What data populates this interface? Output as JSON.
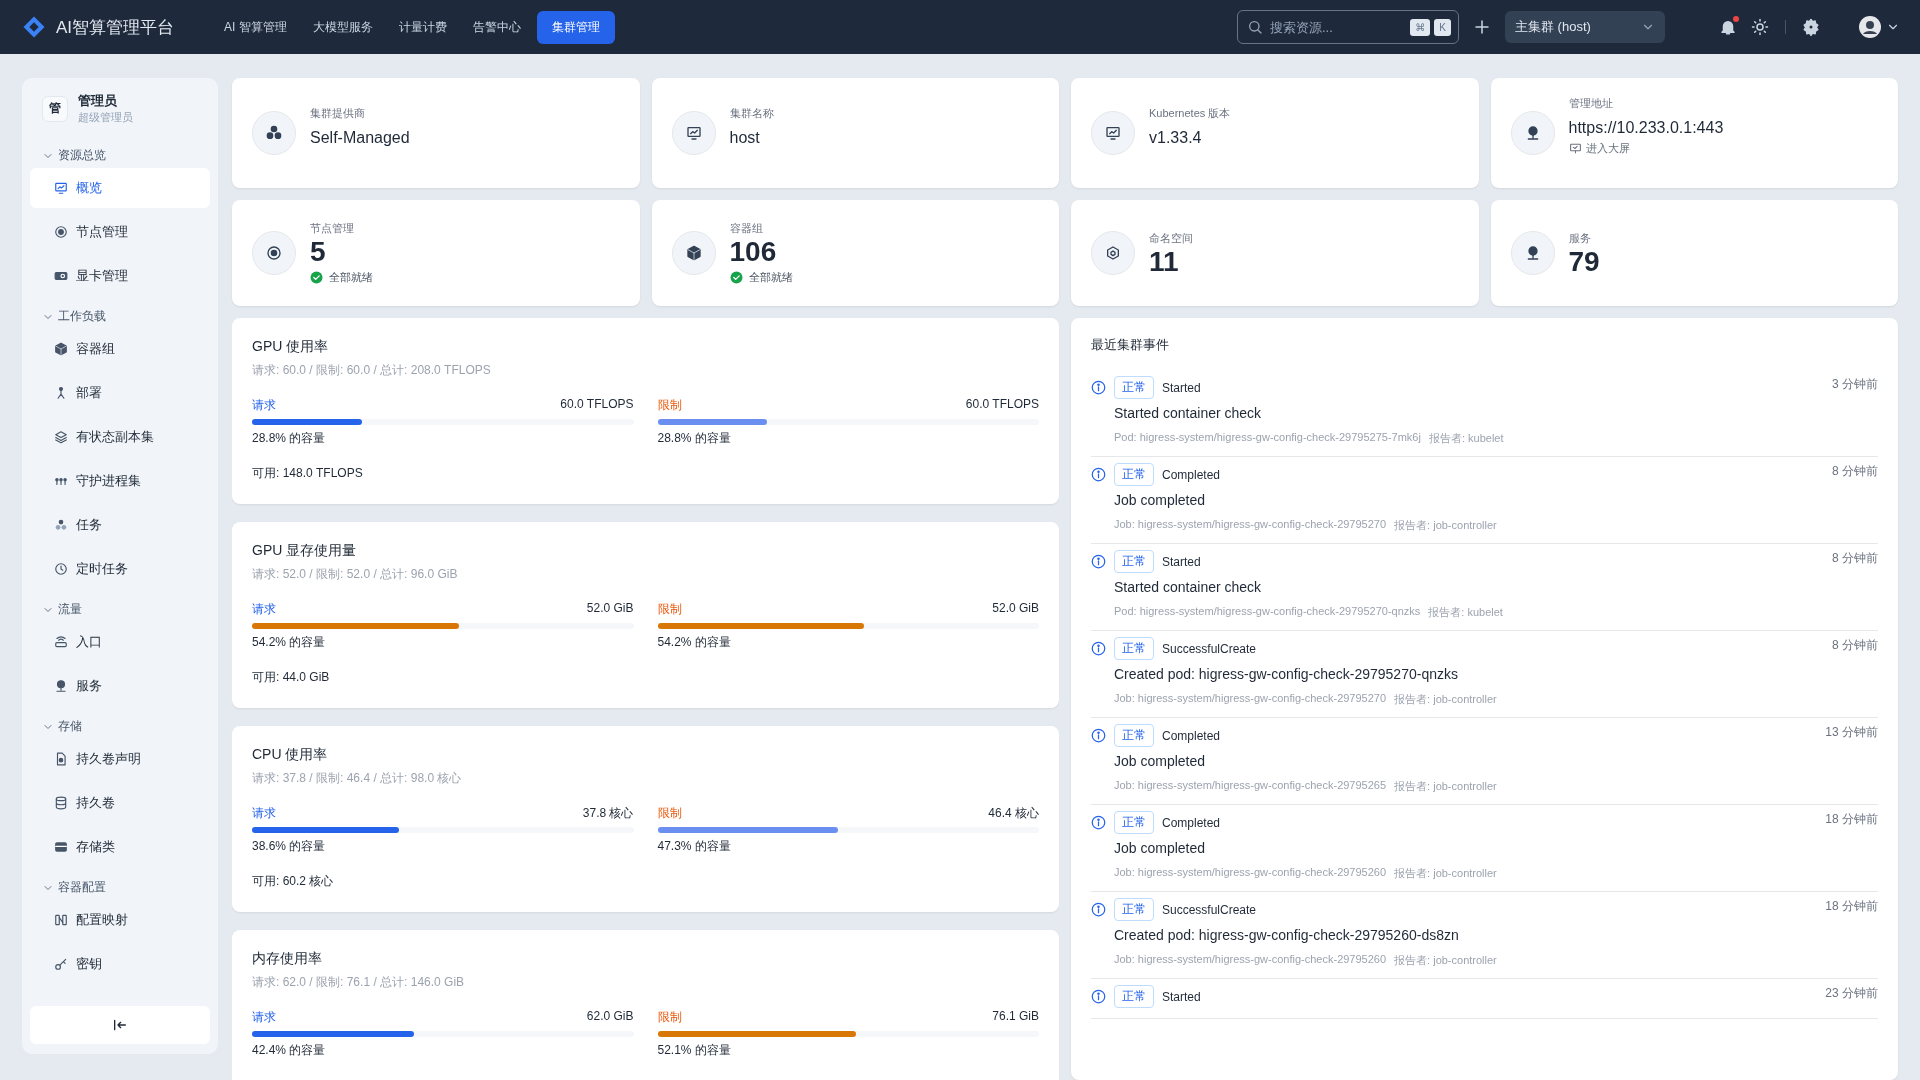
{
  "topbar": {
    "logo_text": "AI智算管理平台",
    "nav": [
      {
        "label": "AI 智算管理",
        "selected": false
      },
      {
        "label": "大模型服务",
        "selected": false
      },
      {
        "label": "计量计费",
        "selected": false
      },
      {
        "label": "告警中心",
        "selected": false
      },
      {
        "label": "集群管理",
        "selected": true
      }
    ],
    "search": {
      "placeholder": "搜索资源...",
      "keys": [
        "⌘",
        "K"
      ]
    },
    "cluster_select": "主集群 (host)",
    "notification_dot": true
  },
  "sidebar": {
    "user": {
      "avatar": "管",
      "name": "管理员",
      "role": "超级管理员"
    },
    "groups": [
      {
        "label": "资源总览",
        "expanded": true,
        "items": [
          {
            "label": "概览",
            "selected": true
          },
          {
            "label": "节点管理",
            "selected": false
          },
          {
            "label": "显卡管理",
            "selected": false
          }
        ]
      },
      {
        "label": "工作负载",
        "expanded": true,
        "items": [
          {
            "label": "容器组",
            "selected": false
          },
          {
            "label": "部署",
            "selected": false
          },
          {
            "label": "有状态副本集",
            "selected": false
          },
          {
            "label": "守护进程集",
            "selected": false
          },
          {
            "label": "任务",
            "selected": false
          },
          {
            "label": "定时任务",
            "selected": false
          }
        ]
      },
      {
        "label": "流量",
        "expanded": true,
        "items": [
          {
            "label": "入口",
            "selected": false
          },
          {
            "label": "服务",
            "selected": false
          }
        ]
      },
      {
        "label": "存储",
        "expanded": true,
        "items": [
          {
            "label": "持久卷声明",
            "selected": false
          },
          {
            "label": "持久卷",
            "selected": false
          },
          {
            "label": "存储类",
            "selected": false
          }
        ]
      },
      {
        "label": "容器配置",
        "expanded": true,
        "items": [
          {
            "label": "配置映射",
            "selected": false
          },
          {
            "label": "密钥",
            "selected": false
          }
        ]
      }
    ]
  },
  "info_cards": [
    {
      "label": "集群提供商",
      "value": "Self-Managed"
    },
    {
      "label": "集群名称",
      "value": "host"
    },
    {
      "label": "Kubernetes 版本",
      "value": "v1.33.4"
    },
    {
      "label": "管理地址",
      "value": "https://10.233.0.1:443",
      "link": "进入大屏"
    }
  ],
  "stat_cards": [
    {
      "label": "节点管理",
      "value": "5",
      "status": "全部就绪"
    },
    {
      "label": "容器组",
      "value": "106",
      "status": "全部就绪"
    },
    {
      "label": "命名空间",
      "value": "11"
    },
    {
      "label": "服务",
      "value": "79"
    }
  ],
  "resources": [
    {
      "title": "GPU 使用率",
      "summary": "请求: 60.0 / 限制: 60.0 / 总计: 208.0 TFLOPS",
      "available": "可用: 148.0 TFLOPS",
      "bars": [
        {
          "label": "请求",
          "value": "60.0 TFLOPS",
          "level": 0.288,
          "color": "#2563eb",
          "caption": "28.8% 的容量"
        },
        {
          "label": "限制",
          "value": "60.0 TFLOPS",
          "level": 0.288,
          "color": "#6b8ff0",
          "caption": "28.8% 的容量"
        }
      ]
    },
    {
      "title": "GPU 显存使用量",
      "summary": "请求: 52.0 / 限制: 52.0 / 总计: 96.0 GiB",
      "available": "可用: 44.0 GiB",
      "bars": [
        {
          "label": "请求",
          "value": "52.0 GiB",
          "level": 0.542,
          "color": "#d97706",
          "caption": "54.2% 的容量"
        },
        {
          "label": "限制",
          "value": "52.0 GiB",
          "level": 0.542,
          "color": "#d97706",
          "caption": "54.2% 的容量"
        }
      ]
    },
    {
      "title": "CPU 使用率",
      "summary": "请求: 37.8 / 限制: 46.4 / 总计: 98.0 核心",
      "available": "可用: 60.2 核心",
      "bars": [
        {
          "label": "请求",
          "value": "37.8 核心",
          "level": 0.386,
          "color": "#2563eb",
          "caption": "38.6% 的容量"
        },
        {
          "label": "限制",
          "value": "46.4 核心",
          "level": 0.473,
          "color": "#6b8ff0",
          "caption": "47.3% 的容量"
        }
      ]
    },
    {
      "title": "内存使用率",
      "summary": "请求: 62.0 / 限制: 76.1 / 总计: 146.0 GiB",
      "bars": [
        {
          "label": "请求",
          "value": "62.0 GiB",
          "level": 0.424,
          "color": "#2563eb",
          "caption": "42.4% 的容量"
        },
        {
          "label": "限制",
          "value": "76.1 GiB",
          "level": 0.521,
          "color": "#d97706",
          "caption": "52.1% 的容量"
        }
      ]
    }
  ],
  "events": {
    "title": "最近集群事件",
    "items": [
      {
        "type": "正常",
        "reason": "Started",
        "time": "3 分钟前",
        "message": "Started container check",
        "source": "Pod: higress-system/higress-gw-config-check-29795275-7mk6j",
        "reporter": "报告者: kubelet"
      },
      {
        "type": "正常",
        "reason": "Completed",
        "time": "8 分钟前",
        "message": "Job completed",
        "source": "Job: higress-system/higress-gw-config-check-29795270",
        "reporter": "报告者: job-controller"
      },
      {
        "type": "正常",
        "reason": "Started",
        "time": "8 分钟前",
        "message": "Started container check",
        "source": "Pod: higress-system/higress-gw-config-check-29795270-qnzks",
        "reporter": "报告者: kubelet"
      },
      {
        "type": "正常",
        "reason": "SuccessfulCreate",
        "time": "8 分钟前",
        "message": "Created pod: higress-gw-config-check-29795270-qnzks",
        "source": "Job: higress-system/higress-gw-config-check-29795270",
        "reporter": "报告者: job-controller"
      },
      {
        "type": "正常",
        "reason": "Completed",
        "time": "13 分钟前",
        "message": "Job completed",
        "source": "Job: higress-system/higress-gw-config-check-29795265",
        "reporter": "报告者: job-controller"
      },
      {
        "type": "正常",
        "reason": "Completed",
        "time": "18 分钟前",
        "message": "Job completed",
        "source": "Job: higress-system/higress-gw-config-check-29795260",
        "reporter": "报告者: job-controller"
      },
      {
        "type": "正常",
        "reason": "SuccessfulCreate",
        "time": "18 分钟前",
        "message": "Created pod: higress-gw-config-check-29795260-ds8zn",
        "source": "Job: higress-system/higress-gw-config-check-29795260",
        "reporter": "报告者: job-controller"
      },
      {
        "type": "正常",
        "reason": "Started",
        "time": "23 分钟前"
      }
    ]
  }
}
